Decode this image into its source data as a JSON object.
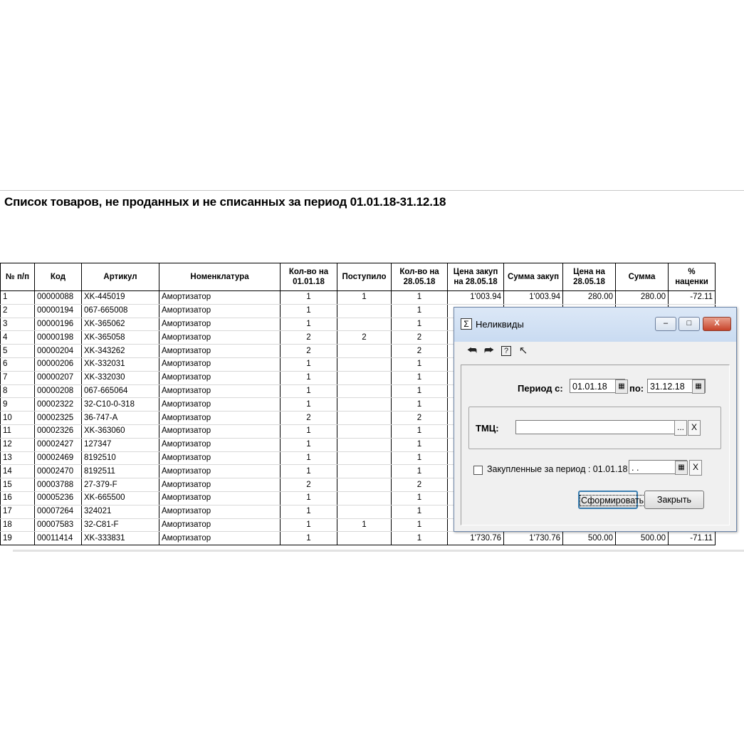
{
  "report": {
    "title": "Список товаров, не проданных и не списанных за период 01.01.18-31.12.18",
    "columns": [
      {
        "line1": "№ п/п",
        "line2": ""
      },
      {
        "line1": "Код",
        "line2": ""
      },
      {
        "line1": "Артикул",
        "line2": ""
      },
      {
        "line1": "Номенклатура",
        "line2": ""
      },
      {
        "line1": "Кол-во на",
        "line2": "01.01.18"
      },
      {
        "line1": "Поступило",
        "line2": ""
      },
      {
        "line1": "Кол-во на",
        "line2": "28.05.18"
      },
      {
        "line1": "Цена закуп",
        "line2": "на 28.05.18"
      },
      {
        "line1": "Сумма закуп",
        "line2": ""
      },
      {
        "line1": "Цена на",
        "line2": "28.05.18"
      },
      {
        "line1": "Сумма",
        "line2": ""
      },
      {
        "line1": "%",
        "line2": "наценки"
      }
    ],
    "rows": [
      [
        "1",
        "00000088",
        "XK-445019",
        "Амортизатор",
        "1",
        "1",
        "1",
        "1'003.94",
        "1'003.94",
        "280.00",
        "280.00",
        "-72.11"
      ],
      [
        "2",
        "00000194",
        "067-665008",
        "Амортизатор",
        "1",
        "",
        "1",
        "",
        "",
        "",
        "",
        ""
      ],
      [
        "3",
        "00000196",
        "XK-365062",
        "Амортизатор",
        "1",
        "",
        "1",
        "",
        "",
        "",
        "",
        ""
      ],
      [
        "4",
        "00000198",
        "XK-365058",
        "Амортизатор",
        "2",
        "2",
        "2",
        "",
        "",
        "",
        "",
        ""
      ],
      [
        "5",
        "00000204",
        "XK-343262",
        "Амортизатор",
        "2",
        "",
        "2",
        "",
        "",
        "",
        "",
        ""
      ],
      [
        "6",
        "00000206",
        "XK-332031",
        "Амортизатор",
        "1",
        "",
        "1",
        "",
        "",
        "",
        "",
        ""
      ],
      [
        "7",
        "00000207",
        "XK-332030",
        "Амортизатор",
        "1",
        "",
        "1",
        "",
        "",
        "",
        "",
        ""
      ],
      [
        "8",
        "00000208",
        "067-665064",
        "Амортизатор",
        "1",
        "",
        "1",
        "",
        "",
        "",
        "",
        ""
      ],
      [
        "9",
        "00002322",
        "32-C10-0-318",
        "Амортизатор",
        "1",
        "",
        "1",
        "",
        "",
        "",
        "",
        ""
      ],
      [
        "10",
        "00002325",
        "36-747-A",
        "Амортизатор",
        "2",
        "",
        "2",
        "",
        "",
        "",
        "",
        ""
      ],
      [
        "11",
        "00002326",
        "XK-363060",
        "Амортизатор",
        "1",
        "",
        "1",
        "",
        "",
        "",
        "",
        ""
      ],
      [
        "12",
        "00002427",
        "127347",
        "Амортизатор",
        "1",
        "",
        "1",
        "",
        "",
        "",
        "",
        ""
      ],
      [
        "13",
        "00002469",
        "8192510",
        "Амортизатор",
        "1",
        "",
        "1",
        "",
        "",
        "",
        "",
        ""
      ],
      [
        "14",
        "00002470",
        "8192511",
        "Амортизатор",
        "1",
        "",
        "1",
        "",
        "",
        "",
        "",
        ""
      ],
      [
        "15",
        "00003788",
        "27-379-F",
        "Амортизатор",
        "2",
        "",
        "2",
        "",
        "",
        "",
        "",
        ""
      ],
      [
        "16",
        "00005236",
        "XK-665500",
        "Амортизатор",
        "1",
        "",
        "1",
        "",
        "",
        "",
        "",
        ""
      ],
      [
        "17",
        "00007264",
        "324021",
        "Амортизатор",
        "1",
        "",
        "1",
        "",
        "",
        "",
        "",
        ""
      ],
      [
        "18",
        "00007583",
        "32-C81-F",
        "Амортизатор",
        "1",
        "1",
        "1",
        "",
        "",
        "",
        "",
        ""
      ],
      [
        "19",
        "00011414",
        "XK-333831",
        "Амортизатор",
        "1",
        "",
        "1",
        "1'730.76",
        "1'730.76",
        "500.00",
        "500.00",
        "-71.11"
      ]
    ]
  },
  "dialog": {
    "title": "Неликвиды",
    "title_icon": "Σ",
    "win_min": "–",
    "win_max": "□",
    "win_close": "X",
    "toolbar_icons": [
      "back-icon",
      "forward-icon",
      "help-icon",
      "whats-this-icon"
    ],
    "period_label": "Период с:",
    "period_from": "01.01.18",
    "period_to_label": "по:",
    "period_to": "31.12.18",
    "tmc_label": "ТМЦ:",
    "tmc_value": "",
    "browse_label": "...",
    "clear_label": "X",
    "purchased_label": "Закупленные за период : 01.01.18 -",
    "purchased_value": " . .",
    "form_button": "Сформировать",
    "close_button": "Закрыть"
  }
}
